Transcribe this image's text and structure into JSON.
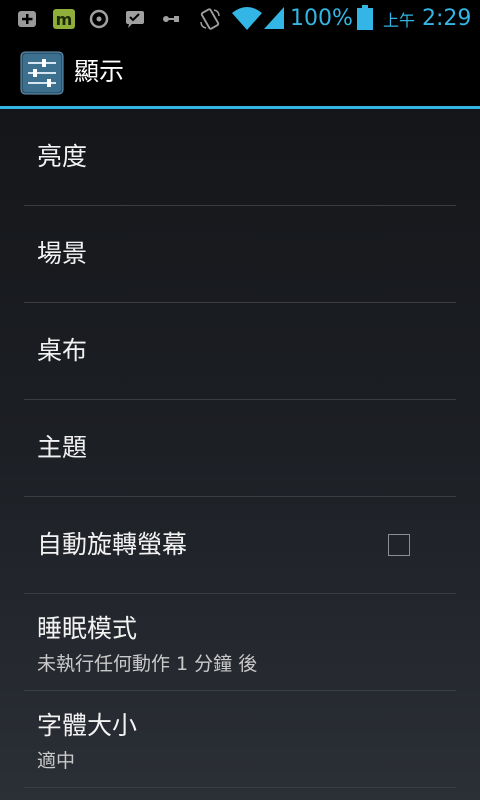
{
  "status_bar": {
    "battery_percent": "100%",
    "ampm": "上午",
    "time": "2:29",
    "icons": [
      "notification-plus-icon",
      "app-m-icon",
      "sync-icon",
      "message-icon",
      "usb-icon",
      "rotate-icon",
      "wifi-icon",
      "signal-icon",
      "battery-icon"
    ],
    "accent_color": "#33b5e5"
  },
  "action_bar": {
    "title": "顯示",
    "icon": "settings-sliders-icon",
    "accent_color": "#33b5e5"
  },
  "settings": {
    "items": [
      {
        "title": "亮度"
      },
      {
        "title": "場景"
      },
      {
        "title": "桌布"
      },
      {
        "title": "主題"
      },
      {
        "title": "自動旋轉螢幕",
        "checked": false
      },
      {
        "title": "睡眠模式",
        "summary": "未執行任何動作 1 分鐘 後"
      },
      {
        "title": "字體大小",
        "summary": "適中"
      }
    ]
  }
}
